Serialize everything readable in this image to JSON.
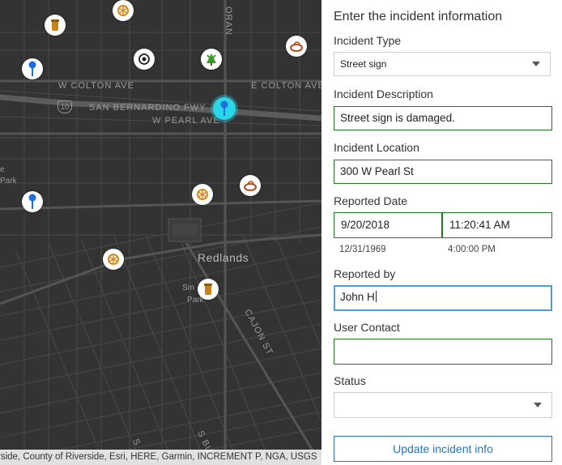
{
  "map": {
    "labels": {
      "w_colton": "W COLTON AVE",
      "e_colton": "E COLTON AVE",
      "fwy": "SAN BERNARDINO FWY",
      "interstate": "10",
      "w_pearl": "W PEARL AVE",
      "orange": "ORAN",
      "city": "Redlands",
      "park_left": "Park",
      "park_left_e": "e",
      "smiley": "Sm",
      "smiley_park": "Park",
      "cajon": "CAJON ST",
      "bottom_s": "S",
      "bottom_bu": "S BU"
    },
    "attribution": "rside, County of Riverside, Esri, HERE, Garmin, INCREMENT P, NGA, USGS",
    "colors": {
      "background": "#333333",
      "selected": "#29d7e8",
      "pin": "#1e6fd9"
    }
  },
  "panel": {
    "title": "Enter the incident information",
    "incident_type": {
      "label": "Incident Type",
      "value": "Street sign"
    },
    "description": {
      "label": "Incident Description",
      "value": "Street sign is damaged."
    },
    "location": {
      "label": "Incident Location",
      "value": "300 W Pearl St"
    },
    "reported_date": {
      "label": "Reported Date",
      "date": "9/20/2018",
      "time": "11:20:41 AM",
      "date_hint": "12/31/1969",
      "time_hint": "4:00:00 PM"
    },
    "reported_by": {
      "label": "Reported by",
      "value": "John H"
    },
    "user_contact": {
      "label": "User Contact",
      "value": ""
    },
    "status": {
      "label": "Status",
      "value": ""
    },
    "button": "Update incident info"
  }
}
